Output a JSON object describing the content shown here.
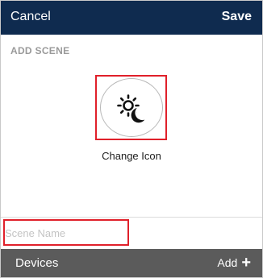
{
  "navbar": {
    "cancel_label": "Cancel",
    "save_label": "Save"
  },
  "section": {
    "header": "ADD SCENE"
  },
  "scene_icon": {
    "icon_name": "day-night-icon",
    "change_label": "Change Icon"
  },
  "scene_name": {
    "value": "",
    "placeholder": "Scene Name"
  },
  "devices": {
    "label": "Devices",
    "add_label": "Add",
    "add_icon": "plus-icon"
  },
  "colors": {
    "navbar_bg": "#0f2b4f",
    "devices_bar_bg": "#5b5b5b",
    "highlight": "#e0202a"
  }
}
